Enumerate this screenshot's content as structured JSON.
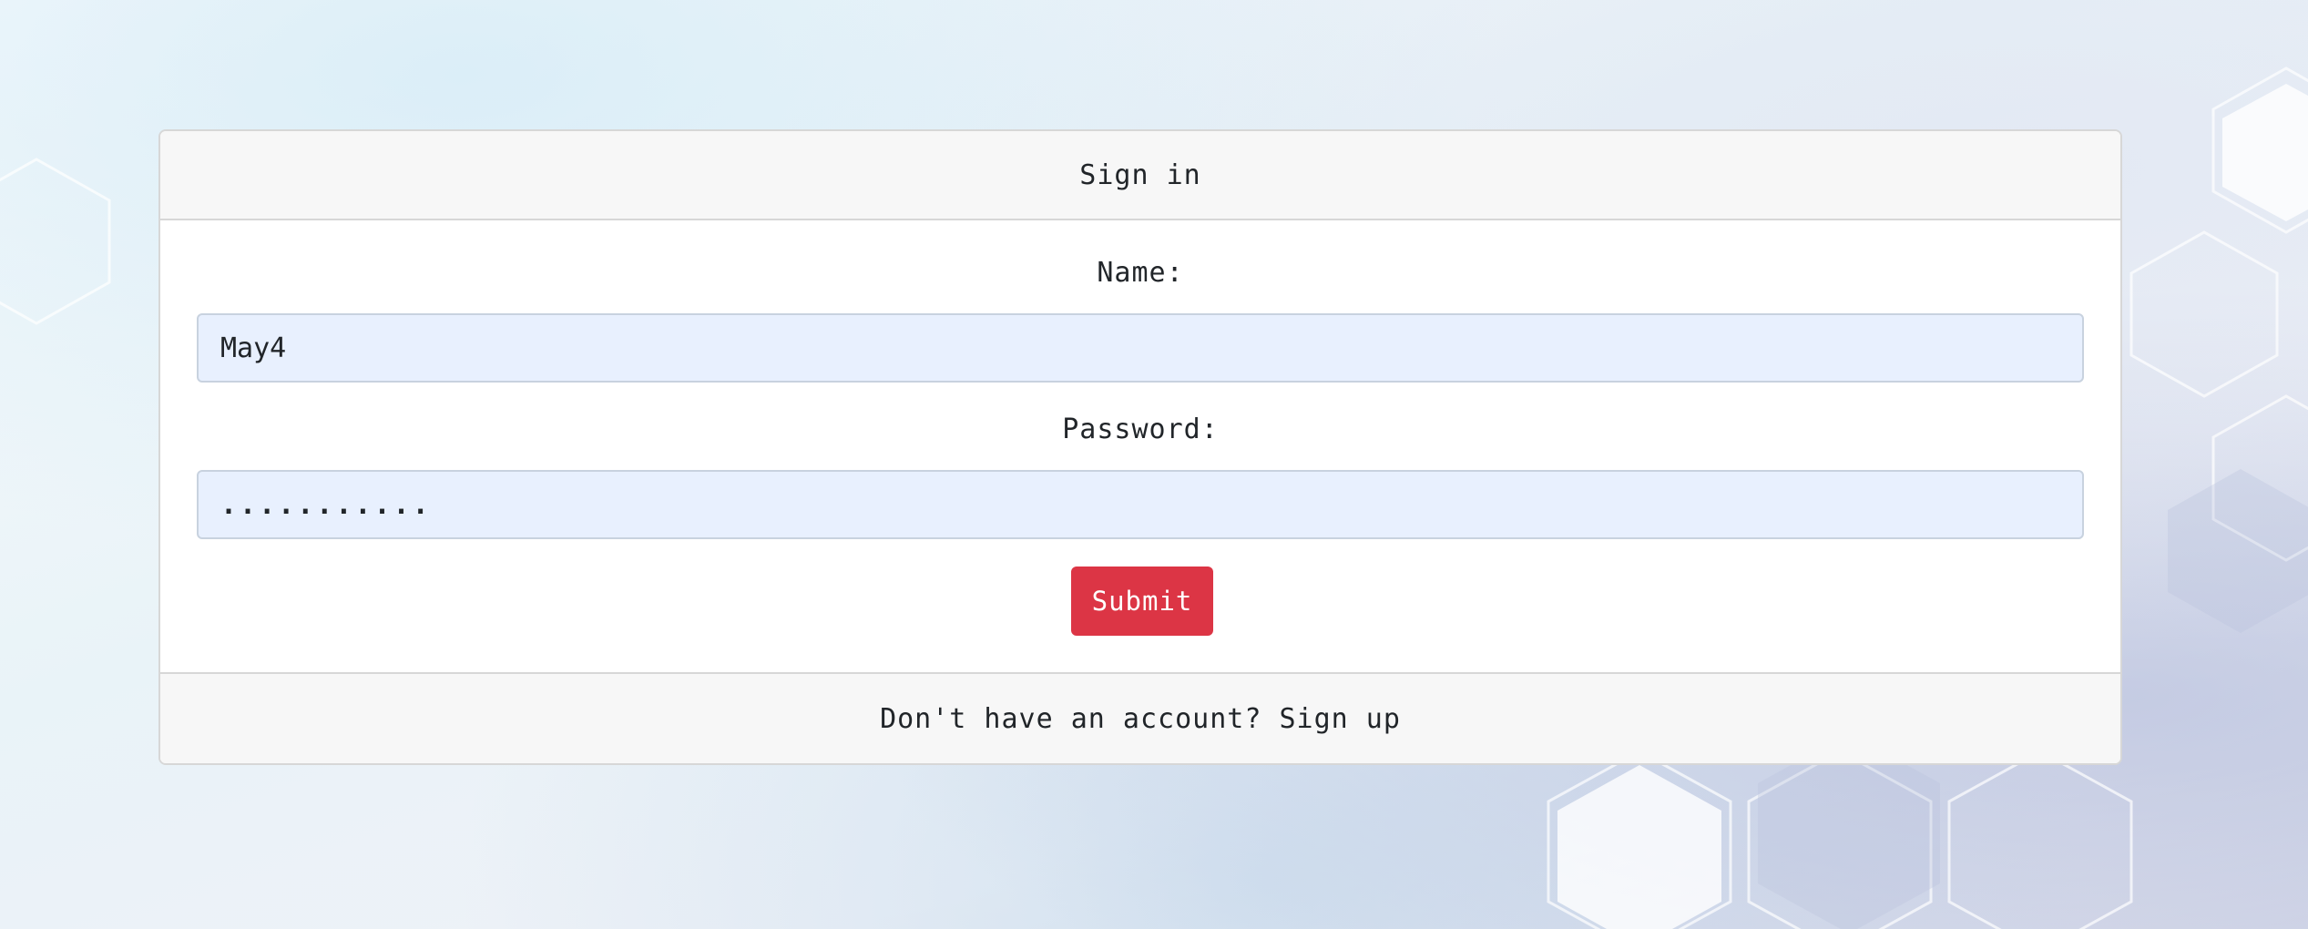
{
  "login": {
    "header_title": "Sign in",
    "name_label": "Name:",
    "name_value": "May4",
    "password_label": "Password:",
    "password_value": "...........",
    "submit_label": "Submit",
    "footer_text": "Don't have an account? ",
    "footer_link": "Sign up"
  },
  "colors": {
    "submit_button": "#dc3545",
    "input_autofill_bg": "#e8f0fe",
    "card_header_bg": "#f7f7f7"
  }
}
